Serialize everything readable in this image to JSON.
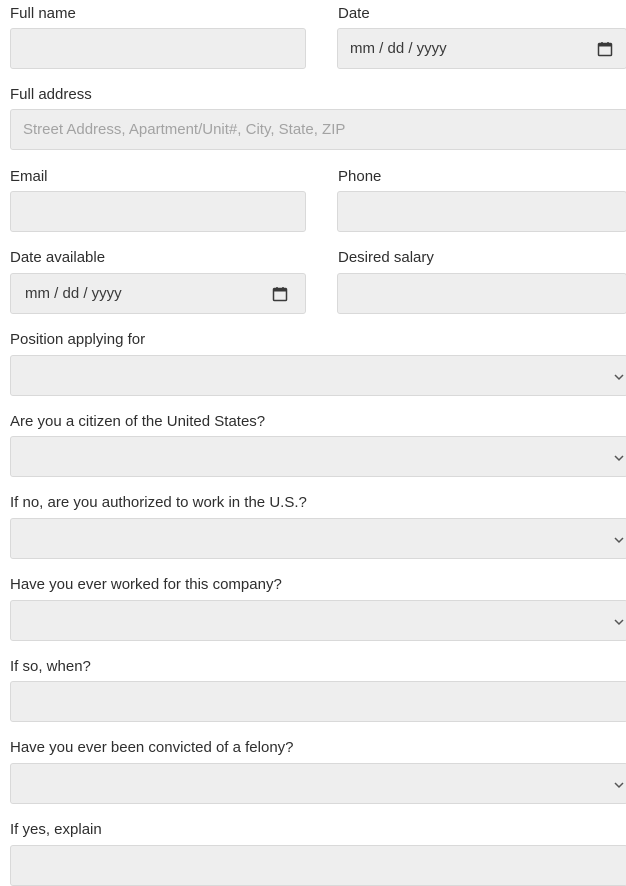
{
  "form": {
    "full_name": {
      "label": "Full name",
      "value": ""
    },
    "date": {
      "label": "Date",
      "value": "mm / dd / yyyy",
      "icon": "calendar-icon"
    },
    "full_address": {
      "label": "Full address",
      "placeholder": "Street Address, Apartment/Unit#, City, State, ZIP",
      "value": ""
    },
    "email": {
      "label": "Email",
      "value": ""
    },
    "phone": {
      "label": "Phone",
      "value": ""
    },
    "date_available": {
      "label": "Date available",
      "value": "mm / dd / yyyy",
      "icon": "calendar-icon"
    },
    "desired_salary": {
      "label": "Desired salary",
      "value": ""
    },
    "position": {
      "label": "Position applying for",
      "value": "",
      "icon": "chevron-down-icon"
    },
    "citizen": {
      "label": "Are you a citizen of the United States?",
      "value": "",
      "icon": "chevron-down-icon"
    },
    "authorized": {
      "label": "If no, are you authorized to work in the U.S.?",
      "value": "",
      "icon": "chevron-down-icon"
    },
    "worked_before": {
      "label": "Have you ever worked for this company?",
      "value": "",
      "icon": "chevron-down-icon"
    },
    "when": {
      "label": "If so, when?",
      "value": ""
    },
    "felony": {
      "label": "Have you ever been convicted of a felony?",
      "value": "",
      "icon": "chevron-down-icon"
    },
    "explain": {
      "label": "If yes, explain",
      "value": ""
    }
  },
  "colors": {
    "field_bg": "#eeeeee",
    "field_border": "#d9d9d9",
    "label_text": "#2e2e2e",
    "placeholder_text": "#a3a3a3"
  }
}
